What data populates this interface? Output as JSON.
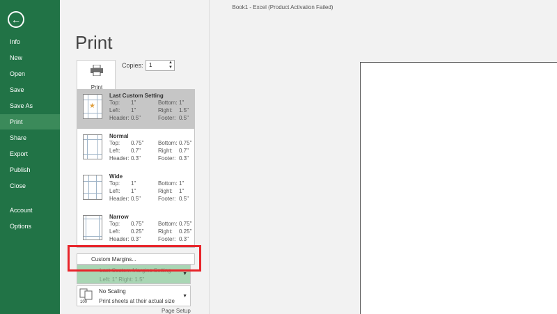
{
  "window": {
    "title": "Book1 - Excel (Product Activation Failed)"
  },
  "sidebar": {
    "back_icon": "left-arrow-icon",
    "items": [
      {
        "label": "Info"
      },
      {
        "label": "New"
      },
      {
        "label": "Open"
      },
      {
        "label": "Save"
      },
      {
        "label": "Save As"
      },
      {
        "label": "Print",
        "active": true
      },
      {
        "label": "Share"
      },
      {
        "label": "Export"
      },
      {
        "label": "Publish"
      },
      {
        "label": "Close"
      },
      {
        "label": "Account"
      },
      {
        "label": "Options"
      }
    ],
    "accent_color": "#217346"
  },
  "main": {
    "title": "Print",
    "print_button": {
      "label": "Print"
    },
    "copies": {
      "label": "Copies:",
      "value": "1"
    }
  },
  "margins_dropdown": {
    "options": [
      {
        "name": "Last Custom Setting",
        "top_label": "Top:",
        "top": "1\"",
        "bottom_label": "Bottom:",
        "bottom": "1\"",
        "left_label": "Left:",
        "left": "1\"",
        "right_label": "Right:",
        "right": "1.5\"",
        "header_label": "Header:",
        "header": "0.5\"",
        "footer_label": "Footer:",
        "footer": "0.5\""
      },
      {
        "name": "Normal",
        "top_label": "Top:",
        "top": "0.75\"",
        "bottom_label": "Bottom:",
        "bottom": "0.75\"",
        "left_label": "Left:",
        "left": "0.7\"",
        "right_label": "Right:",
        "right": "0.7\"",
        "header_label": "Header:",
        "header": "0.3\"",
        "footer_label": "Footer:",
        "footer": "0.3\""
      },
      {
        "name": "Wide",
        "top_label": "Top:",
        "top": "1\"",
        "bottom_label": "Bottom:",
        "bottom": "1\"",
        "left_label": "Left:",
        "left": "1\"",
        "right_label": "Right:",
        "right": "1\"",
        "header_label": "Header:",
        "header": "0.5\"",
        "footer_label": "Footer:",
        "footer": "0.5\""
      },
      {
        "name": "Narrow",
        "top_label": "Top:",
        "top": "0.75\"",
        "bottom_label": "Bottom:",
        "bottom": "0.75\"",
        "left_label": "Left:",
        "left": "0.25\"",
        "right_label": "Right:",
        "right": "0.25\"",
        "header_label": "Header:",
        "header": "0.3\"",
        "footer_label": "Footer:",
        "footer": "0.3\""
      }
    ],
    "custom_margins_label": "Custom Margins...",
    "highlight_color": "#e8242a"
  },
  "settings": {
    "margins": {
      "line1": "Last Custom Margins Setting",
      "line2": "Left: 1\"   Right: 1.5\""
    },
    "scaling": {
      "line1": "No Scaling",
      "line2": "Print sheets at their actual size",
      "icon_text": "100"
    },
    "page_setup_link": "Page Setup"
  }
}
